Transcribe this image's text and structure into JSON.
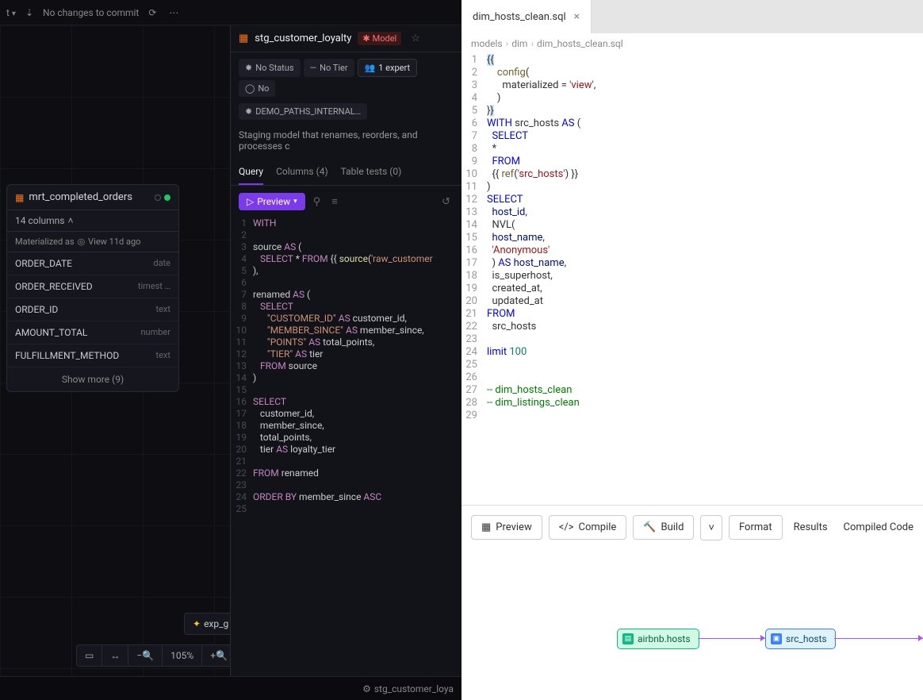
{
  "left": {
    "topbar": {
      "dropdown_suffix": "t",
      "commit_msg": "No changes to commit"
    },
    "node": {
      "name": "mrt_completed_orders",
      "columns_label": "14 columns",
      "materialized": "Materialized as",
      "materialized_type": "View 11d ago",
      "cols": [
        {
          "n": "ORDER_DATE",
          "t": "date"
        },
        {
          "n": "ORDER_RECEIVED",
          "t": "timest …"
        },
        {
          "n": "ORDER_ID",
          "t": "text"
        },
        {
          "n": "AMOUNT_TOTAL",
          "t": "number"
        },
        {
          "n": "FULFILLMENT_METHOD",
          "t": "text"
        }
      ],
      "show_more": "Show more (9)"
    },
    "exp_node": "exp_g",
    "zoom": "105%",
    "detail": {
      "name": "stg_customer_loyalty",
      "model_badge": "Model",
      "chips": {
        "status": "No Status",
        "tier": "No Tier",
        "expert": "1 expert",
        "no": "No",
        "path": "DEMO_PATHS_INTERNAL…"
      },
      "desc": "Staging model that renames, reorders, and processes c",
      "tabs": {
        "query": "Query",
        "columns": "Columns (4)",
        "tests": "Table tests (0)"
      },
      "preview_btn": "Preview",
      "code": [
        {
          "l": 1,
          "h": "<span class='kw'>WITH</span>"
        },
        {
          "l": 2,
          "h": ""
        },
        {
          "l": 3,
          "h": "source <span class='kw'>AS</span> ("
        },
        {
          "l": 4,
          "h": "   <span class='kw'>SELECT</span> * <span class='kw'>FROM</span> {{ <span class='fn'>source</span>(<span class='st'>'raw_customer</span>"
        },
        {
          "l": 5,
          "h": "),"
        },
        {
          "l": 6,
          "h": ""
        },
        {
          "l": 7,
          "h": "renamed <span class='kw'>AS</span> ("
        },
        {
          "l": 8,
          "h": "   <span class='kw'>SELECT</span>"
        },
        {
          "l": 9,
          "h": "      <span class='st'>\"CUSTOMER_ID\"</span> <span class='kw'>AS</span> customer_id,"
        },
        {
          "l": 10,
          "h": "      <span class='st'>\"MEMBER_SINCE\"</span> <span class='kw'>AS</span> member_since,"
        },
        {
          "l": 11,
          "h": "      <span class='st'>\"POINTS\"</span> <span class='kw'>AS</span> total_points,"
        },
        {
          "l": 12,
          "h": "      <span class='st'>\"TIER\"</span> <span class='kw'>AS</span> tier"
        },
        {
          "l": 13,
          "h": "   <span class='kw'>FROM</span> source"
        },
        {
          "l": 14,
          "h": ")"
        },
        {
          "l": 15,
          "h": ""
        },
        {
          "l": 16,
          "h": "<span class='kw'>SELECT</span>"
        },
        {
          "l": 17,
          "h": "   customer_id,"
        },
        {
          "l": 18,
          "h": "   member_since,"
        },
        {
          "l": 19,
          "h": "   total_points,"
        },
        {
          "l": 20,
          "h": "   tier <span class='kw'>AS</span> loyalty_tier"
        },
        {
          "l": 21,
          "h": ""
        },
        {
          "l": 22,
          "h": "<span class='kw'>FROM</span> renamed"
        },
        {
          "l": 23,
          "h": ""
        },
        {
          "l": 24,
          "h": "<span class='kw'>ORDER BY</span> member_since <span class='kw'>ASC</span>"
        },
        {
          "l": 25,
          "h": ""
        }
      ]
    },
    "statusbar": "stg_customer_loya"
  },
  "right": {
    "tab": "dim_hosts_clean.sql",
    "crumbs": [
      "models",
      "dim",
      "dim_hosts_clean.sql"
    ],
    "code": [
      {
        "l": 1,
        "h": "<span class='hl'>{{</span>"
      },
      {
        "l": 2,
        "h": "    <span class='fn'>config</span>("
      },
      {
        "l": 3,
        "h": "      materialized = <span class='st'>'view'</span>,"
      },
      {
        "l": 4,
        "h": "    )"
      },
      {
        "l": 5,
        "h": "}<span class='hl'>}</span>"
      },
      {
        "l": 6,
        "h": "<span class='kw'>WITH</span> src_hosts <span class='kw'>AS</span> ("
      },
      {
        "l": 7,
        "h": "  <span class='kw'>SELECT</span>"
      },
      {
        "l": 8,
        "h": "  *"
      },
      {
        "l": 9,
        "h": "  <span class='kw'>FROM</span>"
      },
      {
        "l": 10,
        "h": "  {{ <span class='fn'>ref</span>(<span class='st'>'src_hosts'</span>) }}"
      },
      {
        "l": 11,
        "h": ")"
      },
      {
        "l": 12,
        "h": "<span class='kw'>SELECT</span>"
      },
      {
        "l": 13,
        "h": "  <span class='nm2'>host_id</span>,"
      },
      {
        "l": 14,
        "h": "  NVL("
      },
      {
        "l": 15,
        "h": "  <span class='nm2'>host_name</span>,"
      },
      {
        "l": 16,
        "h": "  <span class='st'>'Anonymous'</span>"
      },
      {
        "l": 17,
        "h": "  ) <span class='kw'>AS</span> <span class='nm2'>host_name</span>,"
      },
      {
        "l": 18,
        "h": "  is_superhost,"
      },
      {
        "l": 19,
        "h": "  created_at,"
      },
      {
        "l": 20,
        "h": "  updated_at"
      },
      {
        "l": 21,
        "h": "<span class='kw'>FROM</span>"
      },
      {
        "l": 22,
        "h": "  src_hosts"
      },
      {
        "l": 23,
        "h": ""
      },
      {
        "l": 24,
        "h": "<span class='kw'>limit</span> <span class='num'>100</span>"
      },
      {
        "l": 25,
        "h": ""
      },
      {
        "l": 26,
        "h": ""
      },
      {
        "l": 27,
        "h": "<span class='cm'>-- dim_hosts_clean</span>"
      },
      {
        "l": 28,
        "h": "<span class='cm'>-- dim_listings_clean</span>"
      },
      {
        "l": 29,
        "h": ""
      }
    ],
    "actions": {
      "preview": "Preview",
      "compile": "Compile",
      "build": "Build",
      "format": "Format",
      "results": "Results",
      "compiled": "Compiled Code"
    },
    "lineage": {
      "n1": "airbnb.hosts",
      "n2": "src_hosts"
    }
  }
}
